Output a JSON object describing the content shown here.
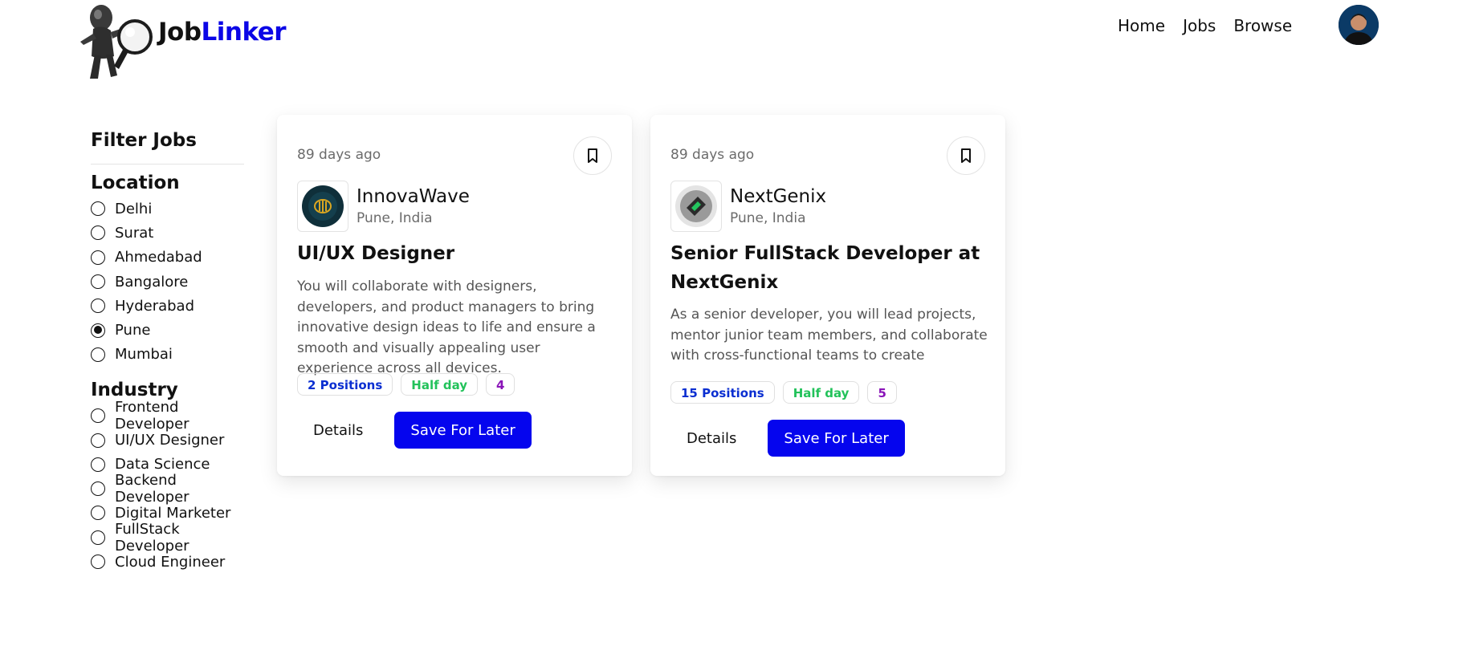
{
  "brand": {
    "part1": "Job",
    "part2": "Linker"
  },
  "nav": {
    "home": "Home",
    "jobs": "Jobs",
    "browse": "Browse"
  },
  "sidebar": {
    "title": "Filter Jobs",
    "groups": [
      {
        "title": "Location",
        "options": [
          "Delhi",
          "Surat",
          "Ahmedabad",
          "Bangalore",
          "Hyderabad",
          "Pune",
          "Mumbai"
        ],
        "selected": "Pune"
      },
      {
        "title": "Industry",
        "options": [
          "Frontend Developer",
          "UI/UX Designer",
          "Data Science",
          "Backend Developer",
          "Digital Marketer",
          "FullStack Developer",
          "Cloud Engineer"
        ],
        "selected": null
      }
    ]
  },
  "jobs": [
    {
      "posted": "89 days ago",
      "company": "InnovaWave",
      "location": "Pune, India",
      "title": "UI/UX Designer",
      "description": "You will collaborate with designers, developers, and product managers to bring innovative design ideas to life and ensure a smooth and visually appealing user experience across all devices.",
      "positions": "2 Positions",
      "type": "Half day",
      "salary": "4",
      "details_label": "Details",
      "save_label": "Save For Later"
    },
    {
      "posted": "89 days ago",
      "company": "NextGenix",
      "location": "Pune, India",
      "title": "Senior FullStack Developer at NextGenix",
      "description": "As a senior developer, you will lead projects, mentor junior team members, and collaborate with cross-functional teams to create seamless",
      "positions": "15 Positions",
      "type": "Half day",
      "salary": "5",
      "details_label": "Details",
      "save_label": "Save For Later"
    }
  ],
  "colors": {
    "accent": "#0505ee",
    "brand_blue": "#0b06e6",
    "badge_blue": "#0b2fd1",
    "badge_green": "#22c25a",
    "badge_purple": "#8a14b8"
  }
}
